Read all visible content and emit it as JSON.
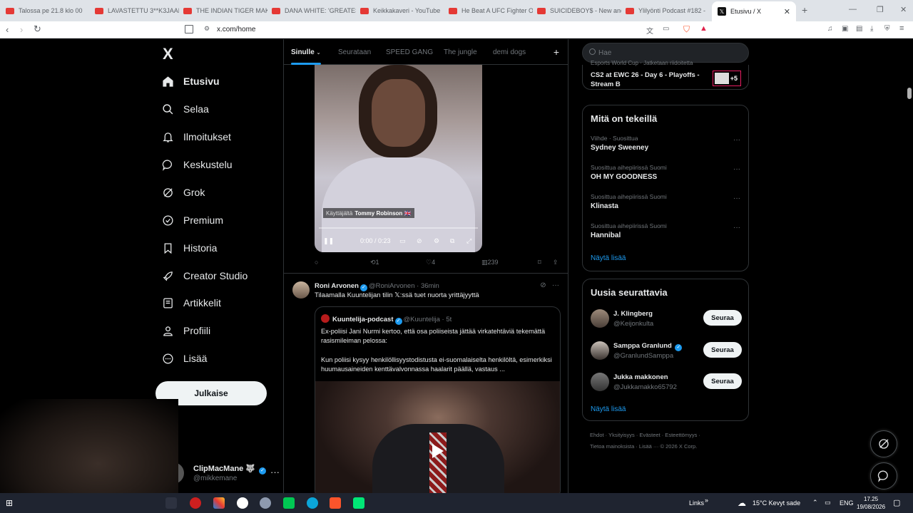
{
  "browser": {
    "tabs": [
      {
        "label": "Talossa pe 21.8 klo 00 "
      },
      {
        "label": "LAVASTETTU 3**K3JAAL"
      },
      {
        "label": "THE INDIAN TIGER MAKE"
      },
      {
        "label": "DANA WHITE: 'GREATES"
      },
      {
        "label": "Keikkakaveri - YouTube"
      },
      {
        "label": "He Beat A UFC Fighter O"
      },
      {
        "label": "SUICIDEBOY$ - New and"
      },
      {
        "label": "Ylilyönti Podcast #182 -"
      },
      {
        "label": "Etusivu / X"
      }
    ],
    "url": "x.com/home"
  },
  "sidebar": {
    "logo": "X",
    "items": [
      {
        "label": "Etusivu",
        "icon": "home-icon"
      },
      {
        "label": "Selaa",
        "icon": "search-icon"
      },
      {
        "label": "Ilmoitukset",
        "icon": "bell-icon"
      },
      {
        "label": "Keskustelu",
        "icon": "chat-icon"
      },
      {
        "label": "Grok",
        "icon": "grok-icon"
      },
      {
        "label": "Premium",
        "icon": "premium-icon"
      },
      {
        "label": "Historia",
        "icon": "bookmark-icon"
      },
      {
        "label": "Creator Studio",
        "icon": "rocket-icon"
      },
      {
        "label": "Artikkelit",
        "icon": "article-icon"
      },
      {
        "label": "Profiili",
        "icon": "person-icon"
      },
      {
        "label": "Lisää",
        "icon": "more-circle-icon"
      }
    ],
    "post_label": "Julkaise",
    "account": {
      "name": "ClipMacMane 🐺",
      "handle": "@mikkemane"
    }
  },
  "timeline": {
    "tabs": [
      "Sinulle",
      "Seurataan",
      "SPEED GANG",
      "The jungle",
      "demi dogs"
    ],
    "video1": {
      "caption_prefix": "Käyttäjältä",
      "caption_user": "Tommy Robinson 🇬🇧",
      "time": "0:00 / 0:23",
      "retweets": "1",
      "likes": "4",
      "views": "239"
    },
    "tweet2": {
      "name": "Roni Arvonen",
      "handle": "@RoniArvonen · 36min",
      "text": "Tilaamalla Kuuntelijan tilin 𝕏:ssä tuet nuorta yrittäjyyttä",
      "quote": {
        "name": "Kuuntelija-podcast",
        "handle": "@Kuuntelija · 5t",
        "text1": "Ex-poliisi Jani Nurmi kertoo, että osa poliiseista jättää virkatehtäviä tekemättä rasismileiman pelossa:",
        "text2": "Kun poliisi kysyy henkilöllisyystodistusta ei-suomalaiselta henkilöltä, esimerkiksi huumausaineiden kenttävalvonnassa haalarit päällä, vastaus ..."
      }
    }
  },
  "right": {
    "search_placeholder": "Hae",
    "event": {
      "meta": "Esports World Cup · Jatketaan riidoitetta",
      "title": "CS2 at EWC 26 - Day 6 - Playoffs - Stream B",
      "badge": "+5"
    },
    "trends_title": "Mitä on tekeillä",
    "trends": [
      {
        "meta": "Viihde · Suosittua",
        "name": "Sydney Sweeney"
      },
      {
        "meta": "Suosittua aihepiirissä Suomi",
        "name": "OH MY GOODNESS"
      },
      {
        "meta": "Suosittua aihepiirissä Suomi",
        "name": "Klinasta"
      },
      {
        "meta": "Suosittua aihepiirissä Suomi",
        "name": "Hannibal"
      }
    ],
    "show_more": "Näytä lisää",
    "who_title": "Uusia seurattavia",
    "who": [
      {
        "name": "J. Klingberg",
        "handle": "@Keijonkulta",
        "button": "Seuraa"
      },
      {
        "name": "Samppa Granlund",
        "handle": "@GranlundSamppa",
        "button": "Seuraa"
      },
      {
        "name": "Jukka makkonen",
        "handle": "@Jukkamakko65792",
        "button": "Seuraa"
      }
    ],
    "show_more2": "Näytä lisää",
    "footer1": "Ehdot · Yksityisyys · Evästeet · Esteettömyys ·",
    "footer2": "Tietoa mainoksista · Lisää ··· © 2026 X Corp."
  },
  "taskbar": {
    "links": "Links",
    "weather": "15°C Kevyt sade",
    "lang": "ENG",
    "time": "17.25",
    "date": "19/08/2026"
  }
}
